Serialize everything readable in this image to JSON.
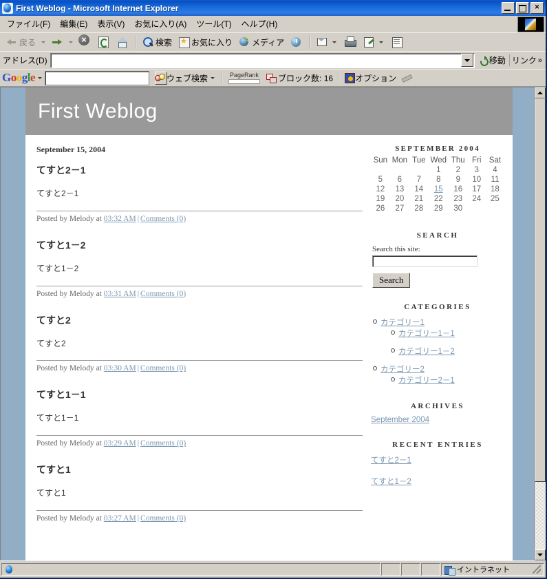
{
  "window": {
    "title": "First Weblog - Microsoft Internet Explorer",
    "icon": "ie-icon",
    "minimize_label": "Minimize",
    "maximize_label": "Maximize",
    "close_label": "✕"
  },
  "menubar": {
    "items": [
      {
        "label": "ファイル(F)",
        "name": "menu-file"
      },
      {
        "label": "編集(E)",
        "name": "menu-edit"
      },
      {
        "label": "表示(V)",
        "name": "menu-view"
      },
      {
        "label": "お気に入り(A)",
        "name": "menu-favorites"
      },
      {
        "label": "ツール(T)",
        "name": "menu-tools"
      },
      {
        "label": "ヘルプ(H)",
        "name": "menu-help"
      }
    ]
  },
  "toolbar": {
    "back_label": "戻る",
    "forward_label": "",
    "stop_label": "",
    "refresh_label": "",
    "home_label": "",
    "search_label": "検索",
    "favorites_label": "お気に入り",
    "media_label": "メディア",
    "history_label": "",
    "mail_label": "",
    "print_label": "",
    "edit_label": "",
    "discuss_label": ""
  },
  "addressbar": {
    "label": "アドレス(D)",
    "value": "",
    "placeholder": "",
    "go_label": "移動",
    "links_label": "リンク",
    "chevron": "»"
  },
  "google_toolbar": {
    "logo": [
      "G",
      "o",
      "o",
      "g",
      "l",
      "e"
    ],
    "search_value": "",
    "web_search_label": "ウェブ検索",
    "pagerank_label": "PageRank",
    "blocked_label": "ブロック数: 16",
    "options_label": "オプション"
  },
  "page": {
    "banner_title": "First Weblog",
    "date_heading": "September 15, 2004",
    "entries": [
      {
        "title": "てすと2－1",
        "body": "てすと2－1",
        "posted_prefix": "Posted by Melody at ",
        "time": "03:32 AM",
        "comments": "Comments (0)"
      },
      {
        "title": "てすと1－2",
        "body": "てすと1－2",
        "posted_prefix": "Posted by Melody at ",
        "time": "03:31 AM",
        "comments": "Comments (0)"
      },
      {
        "title": "てすと2",
        "body": "てすと2",
        "posted_prefix": "Posted by Melody at ",
        "time": "03:30 AM",
        "comments": "Comments (0)"
      },
      {
        "title": "てすと1－1",
        "body": "てすと1－1",
        "posted_prefix": "Posted by Melody at ",
        "time": "03:29 AM",
        "comments": "Comments (0)"
      },
      {
        "title": "てすと1",
        "body": "てすと1",
        "posted_prefix": "Posted by Melody at ",
        "time": "03:27 AM",
        "comments": "Comments (0)"
      }
    ],
    "sidebar": {
      "calendar": {
        "title": "SEPTEMBER 2004",
        "weekdays": [
          "Sun",
          "Mon",
          "Tue",
          "Wed",
          "Thu",
          "Fri",
          "Sat"
        ],
        "weeks": [
          [
            "",
            "",
            "",
            "1",
            "2",
            "3",
            "4"
          ],
          [
            "5",
            "6",
            "7",
            "8",
            "9",
            "10",
            "11"
          ],
          [
            "12",
            "13",
            "14",
            "15",
            "16",
            "17",
            "18"
          ],
          [
            "19",
            "20",
            "21",
            "22",
            "23",
            "24",
            "25"
          ],
          [
            "26",
            "27",
            "28",
            "29",
            "30",
            "",
            ""
          ]
        ],
        "linked_days": [
          "15"
        ]
      },
      "search": {
        "title": "SEARCH",
        "label": "Search this site:",
        "value": "",
        "placeholder": "",
        "button_label": "Search"
      },
      "categories": {
        "title": "CATEGORIES",
        "items": [
          {
            "label": "カテゴリー1",
            "children": [
              {
                "label": "カテゴリー1－1"
              },
              {
                "label": "カテゴリー1－2"
              }
            ]
          },
          {
            "label": "カテゴリー2",
            "children": [
              {
                "label": "カテゴリー2－1"
              }
            ]
          }
        ]
      },
      "archives": {
        "title": "ARCHIVES",
        "items": [
          "September 2004"
        ]
      },
      "recent_entries": {
        "title": "RECENT ENTRIES",
        "items": [
          "てすと2－1",
          "てすと1－2"
        ]
      }
    }
  },
  "statusbar": {
    "message": "",
    "zone": "イントラネット"
  },
  "colors": {
    "page_bg": "#91aec6",
    "banner_bg": "#999999",
    "link": "#7c98b3",
    "chrome": "#d4d0c8",
    "titlebar": "#0a4ec0"
  }
}
